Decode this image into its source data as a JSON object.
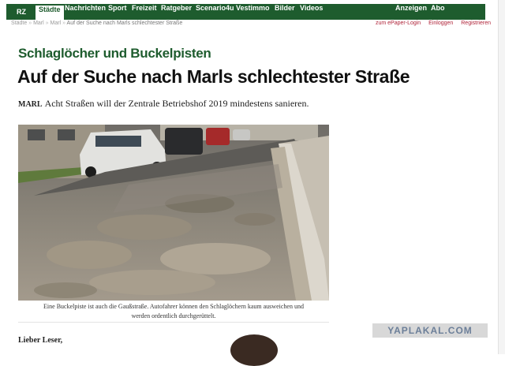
{
  "nav": {
    "logo": "RZ",
    "items": [
      {
        "label": "Städte",
        "active": true
      },
      {
        "label": "Nachrichten"
      },
      {
        "label": "Sport"
      },
      {
        "label": "Freizeit"
      },
      {
        "label": "Ratgeber"
      },
      {
        "label": "Scenario4u"
      },
      {
        "label": "Vestimmo"
      },
      {
        "label": "Bilder"
      },
      {
        "label": "Videos"
      }
    ],
    "right_items": [
      {
        "label": "Anzeigen"
      },
      {
        "label": "Abo"
      }
    ]
  },
  "breadcrumb": [
    "Städte",
    "Marl",
    "Marl",
    "Auf der Suche nach Marls schlechtester Straße"
  ],
  "top_links": [
    "zum ePaper-Login",
    "Einloggen",
    "Registrieren"
  ],
  "article": {
    "kicker": "Schlaglöcher und Buckelpisten",
    "headline": "Auf der Suche nach Marls schlechtester Straße",
    "dateline": "MARL",
    "teaser": "Acht Straßen will der Zentrale Betriebshof 2019 mindestens sanieren.",
    "caption_line1": "Eine Buckelpiste ist auch die Gaußstraße. Autofahrer können den Schlaglöchern kaum ausweichen und",
    "caption_line2": "werden ordentlich durchgerüttelt.",
    "salutation": "Lieber Leser,"
  },
  "watermark": "YAPLAKAL.COM",
  "colors": {
    "brand_green": "#1e5c2e",
    "link_red": "#b0253a"
  }
}
